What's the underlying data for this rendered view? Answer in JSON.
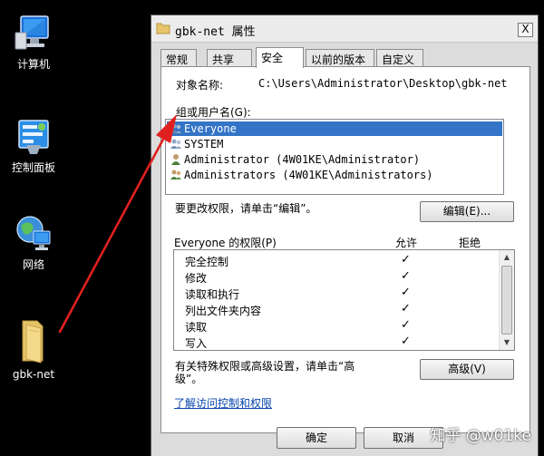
{
  "desktop": {
    "icons": [
      {
        "label": "计算机",
        "icon": "computer-icon"
      },
      {
        "label": "控制面板",
        "icon": "control-panel-icon"
      },
      {
        "label": "网络",
        "icon": "network-icon"
      },
      {
        "label": "gbk-net",
        "icon": "folder-icon"
      }
    ]
  },
  "window": {
    "title": "gbk-net 属性",
    "close_glyph": "X",
    "tabs": [
      {
        "label": "常规",
        "active": false
      },
      {
        "label": "共享",
        "active": false
      },
      {
        "label": "安全",
        "active": true
      },
      {
        "label": "以前的版本",
        "active": false
      },
      {
        "label": "自定义",
        "active": false
      }
    ],
    "object_name_label": "对象名称:",
    "object_name_value": "C:\\Users\\Administrator\\Desktop\\gbk-net",
    "group_label": "组或用户名(G):",
    "users": [
      {
        "name": "Everyone",
        "selected": true
      },
      {
        "name": "SYSTEM",
        "selected": false
      },
      {
        "name": "Administrator (4W01KE\\Administrator)",
        "selected": false
      },
      {
        "name": "Administrators (4W01KE\\Administrators)",
        "selected": false
      }
    ],
    "change_hint": "要更改权限，请单击“编辑”。",
    "edit_button": "编辑(E)...",
    "perm_title": "Everyone 的权限(P)",
    "allow_label": "允许",
    "deny_label": "拒绝",
    "permissions": [
      {
        "name": "完全控制",
        "allow": "✓",
        "deny": ""
      },
      {
        "name": "修改",
        "allow": "✓",
        "deny": ""
      },
      {
        "name": "读取和执行",
        "allow": "✓",
        "deny": ""
      },
      {
        "name": "列出文件夹内容",
        "allow": "✓",
        "deny": ""
      },
      {
        "name": "读取",
        "allow": "✓",
        "deny": ""
      },
      {
        "name": "写入",
        "allow": "✓",
        "deny": ""
      }
    ],
    "special_hint_line1": "有关特殊权限或高级设置，请单击“高",
    "special_hint_line2": "级”。",
    "advanced_button": "高级(V)",
    "learn_link": "了解访问控制和权限",
    "ok_button": "确定",
    "cancel_button": "取消"
  },
  "watermark": "知乎 @w01ke",
  "colors": {
    "annotation_arrow": "#e02020",
    "selection": "#3374c6",
    "link": "#0645ad"
  }
}
